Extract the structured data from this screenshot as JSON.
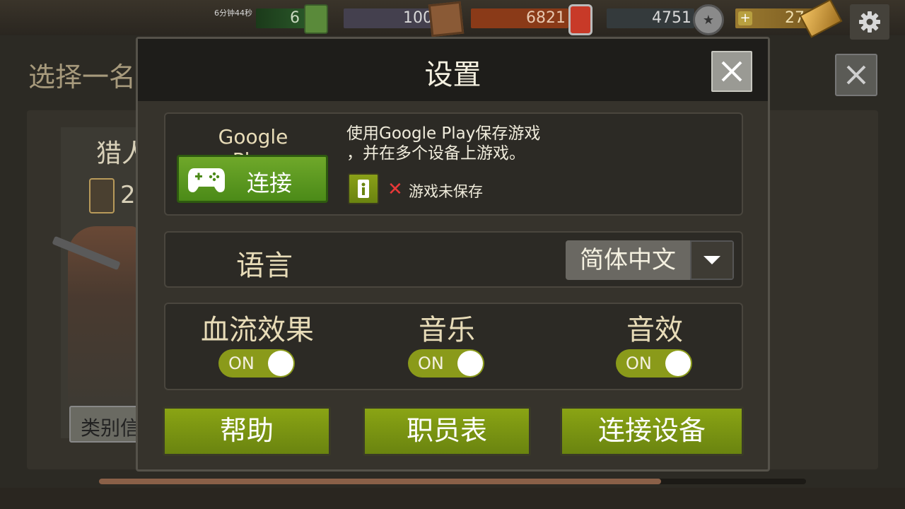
{
  "resources": {
    "timer": "6分钟44秒",
    "fuel": "6",
    "boxes": "100",
    "food": "6821",
    "badges": "4751",
    "gold": "27"
  },
  "background": {
    "title": "选择一名",
    "hunter_name": "猎人",
    "target_count": "2",
    "category_button": "类别信"
  },
  "modal": {
    "title": "设置",
    "google_play": {
      "label": "Google Play",
      "connect_label": "连接",
      "description_line1": "使用Google Play保存游戏",
      "description_line2": "，并在多个设备上游戏。",
      "save_status": "游戏未保存"
    },
    "language": {
      "label": "语言",
      "selected": "简体中文"
    },
    "toggles": {
      "blood": {
        "label": "血流效果",
        "state": "ON"
      },
      "music": {
        "label": "音乐",
        "state": "ON"
      },
      "sound": {
        "label": "音效",
        "state": "ON"
      }
    },
    "buttons": {
      "help": "帮助",
      "credits": "职员表",
      "connect_devices": "连接设备"
    }
  },
  "colors": {
    "accent_green": "#6fa82a",
    "button_olive": "#8aa414",
    "toggle_on": "#8a9a1a"
  }
}
